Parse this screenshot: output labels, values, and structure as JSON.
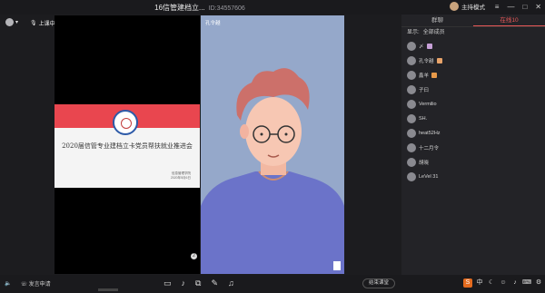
{
  "window": {
    "title": "16信管建档立...",
    "room_id": "ID:34557606",
    "mode_label": "主持模式"
  },
  "header": {
    "user_label": "",
    "mic_label": "上课中"
  },
  "slide": {
    "title": "2020届信管专业建档立卡党员帮扶就业推进会",
    "org": "信息管理学院",
    "date": "2020年5月6日",
    "page_badge": "2"
  },
  "camera": {
    "name": "孔令越"
  },
  "panel": {
    "tabs": [
      {
        "label": "群聊"
      },
      {
        "label": "在线10"
      }
    ],
    "filter_label": "显示:",
    "filter_value": "全部成员",
    "members": [
      {
        "name": "〆",
        "color": "#c7a0d8"
      },
      {
        "name": "孔令越",
        "color": "#e8a36a"
      },
      {
        "name": "鑫羊",
        "color": "#e89a4a"
      },
      {
        "name": "子曰",
        "color": ""
      },
      {
        "name": "Vermilio",
        "color": ""
      },
      {
        "name": "SH.",
        "color": ""
      },
      {
        "name": "heat52Hz",
        "color": ""
      },
      {
        "name": "十二月令",
        "color": ""
      },
      {
        "name": "胡晓",
        "color": ""
      },
      {
        "name": "LeVel 31",
        "color": ""
      }
    ]
  },
  "bottom": {
    "request_label": "发言申请",
    "end_label": "结束课堂",
    "ime_label": "S"
  }
}
